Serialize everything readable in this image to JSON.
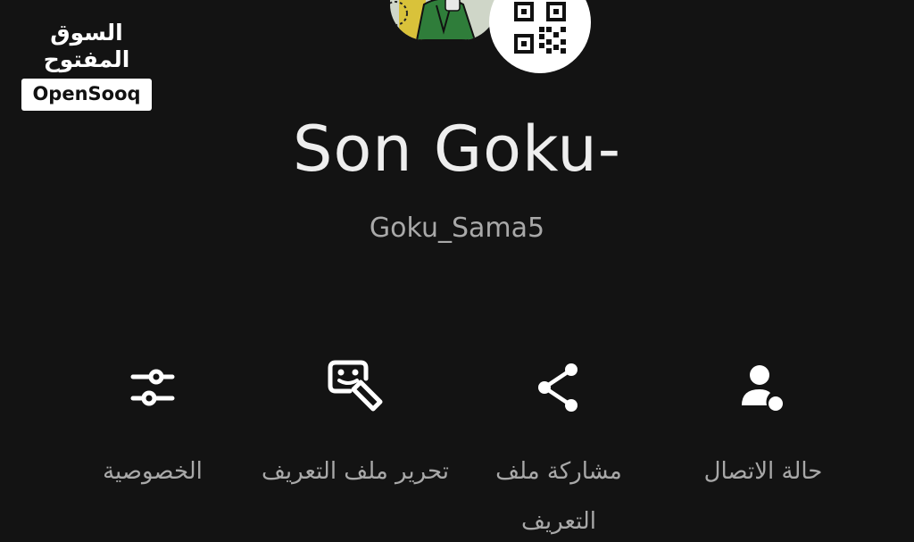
{
  "watermark": {
    "arabic": "السوق المفتوح",
    "latin": "OpenSooq"
  },
  "profile": {
    "display_name": "Son Goku-",
    "username": "Goku_Sama5",
    "qr_icon": "qr-code-icon"
  },
  "actions": [
    {
      "id": "privacy",
      "label": "الخصوصية",
      "icon": "sliders-icon"
    },
    {
      "id": "edit",
      "label": "تحرير ملف التعريف",
      "icon": "edit-face-icon"
    },
    {
      "id": "share",
      "label": "مشاركة ملف التعريف",
      "icon": "share-icon"
    },
    {
      "id": "status",
      "label": "حالة الاتصال",
      "icon": "person-status-icon"
    }
  ],
  "colors": {
    "background": "#131313",
    "name_text": "#eeeeee",
    "muted_text": "#a8a8a8",
    "icon": "#ffffff"
  }
}
